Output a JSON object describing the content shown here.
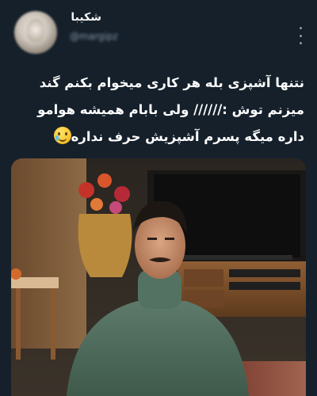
{
  "author": {
    "display_name": "شکیبا",
    "handle": "@margipz"
  },
  "tweet": {
    "lines": [
      "نتنها آشپزی بله هر کاری میخوام بکنم گند",
      "میزنم توش :////// ولی بابام همیشه هوامو",
      "داره میگه پسرم آشپزیش حرف نداره"
    ],
    "emoji": "face-holding-back-tears-icon"
  },
  "media": {
    "kind": "photo",
    "subject": "man-in-green-turtleneck"
  },
  "colors": {
    "background": "#15202b",
    "text": "#ffffff",
    "secondary_text": "#8899a6"
  }
}
